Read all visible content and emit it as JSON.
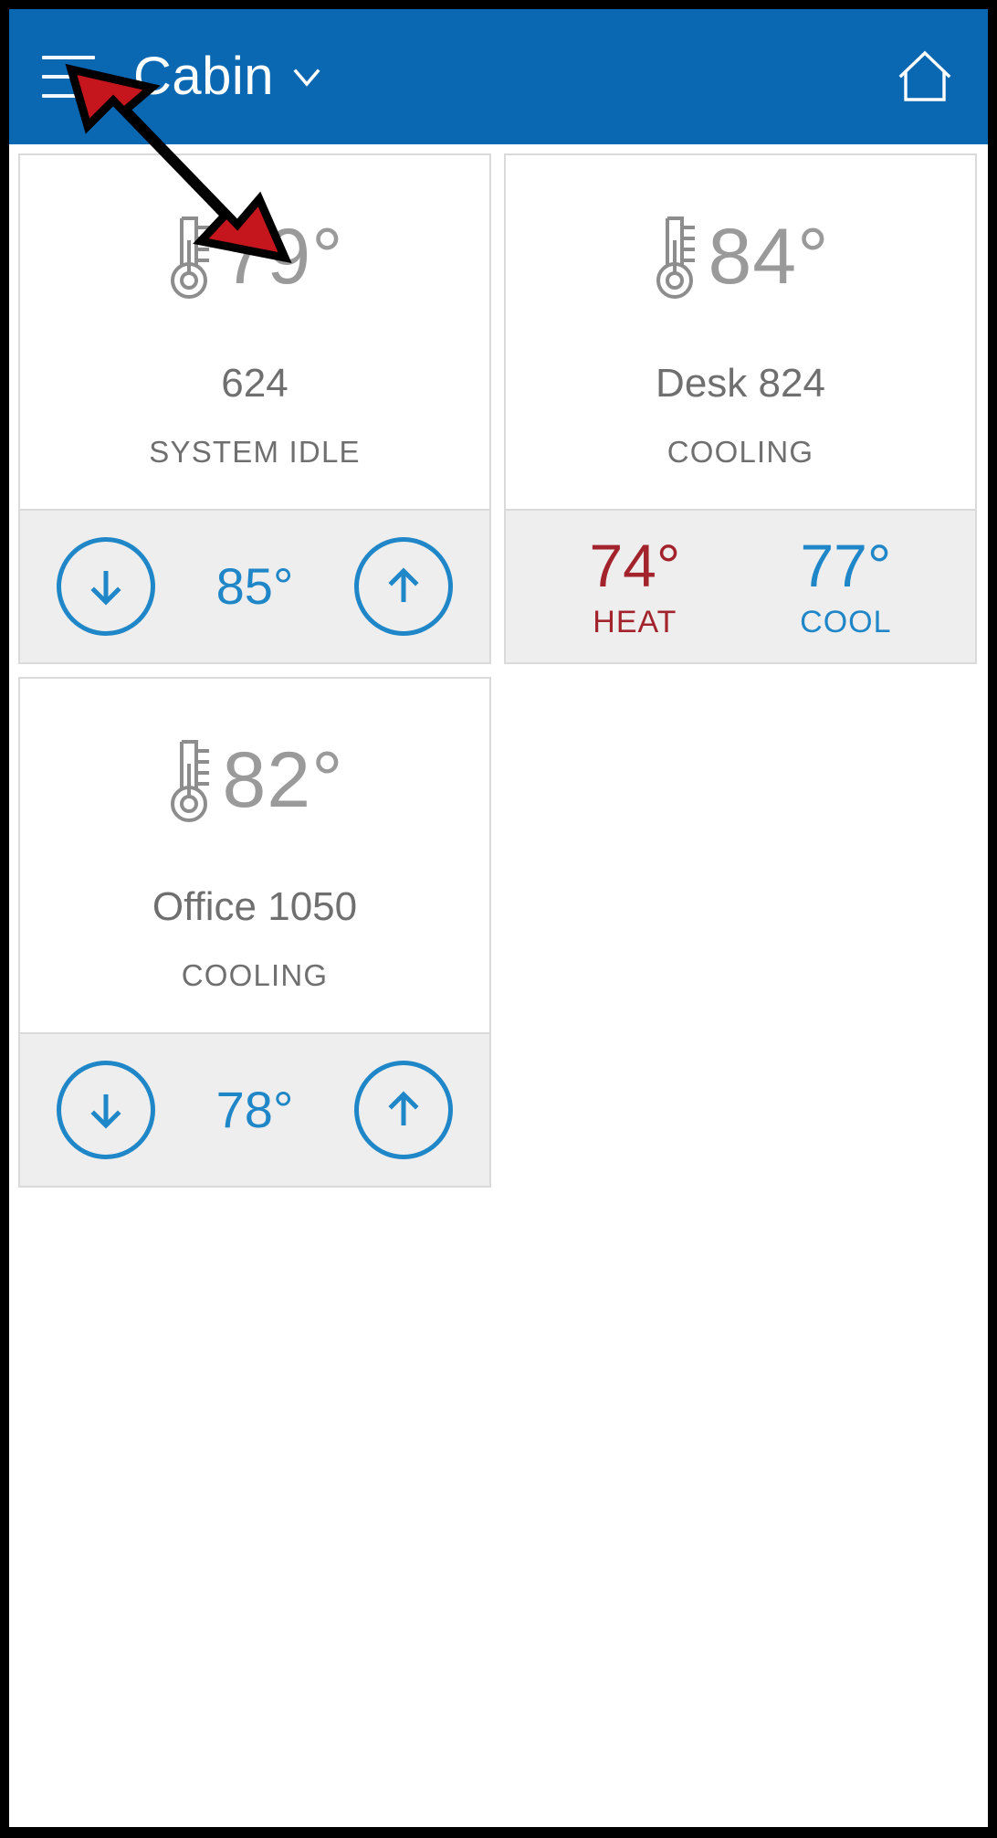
{
  "header": {
    "menu_icon": "hamburger-menu-icon",
    "title": "Cabin",
    "dropdown_icon": "chevron-down-icon",
    "home_icon": "home-icon",
    "background_color": "#0a67b2",
    "text_color": "#ffffff"
  },
  "annotation": {
    "type": "arrow",
    "points_at": "hamburger-menu-icon",
    "fill_color": "#c4161c",
    "stroke_color": "#000000"
  },
  "colors": {
    "accent_blue": "#1f86c8",
    "heat_red": "#a3232c",
    "cool_blue": "#1f86c8",
    "muted_gray": "#9a9a9a",
    "label_gray": "#6f6f6f",
    "card_border": "#dadada",
    "footer_bg": "#eeeeee"
  },
  "cards": [
    {
      "thermometer_icon": "thermometer-icon",
      "current_temp": "79°",
      "zone_name": "624",
      "status": "SYSTEM IDLE",
      "footer_type": "stepper",
      "decrease_icon": "arrow-down-icon",
      "setpoint": "85°",
      "increase_icon": "arrow-up-icon"
    },
    {
      "thermometer_icon": "thermometer-icon",
      "current_temp": "84°",
      "zone_name": "Desk 824",
      "status": "COOLING",
      "footer_type": "dual-setpoint",
      "heat_temp": "74°",
      "heat_label": "HEAT",
      "cool_temp": "77°",
      "cool_label": "COOL"
    },
    {
      "thermometer_icon": "thermometer-icon",
      "current_temp": "82°",
      "zone_name": "Office 1050",
      "status": "COOLING",
      "footer_type": "stepper",
      "decrease_icon": "arrow-down-icon",
      "setpoint": "78°",
      "increase_icon": "arrow-up-icon"
    }
  ]
}
